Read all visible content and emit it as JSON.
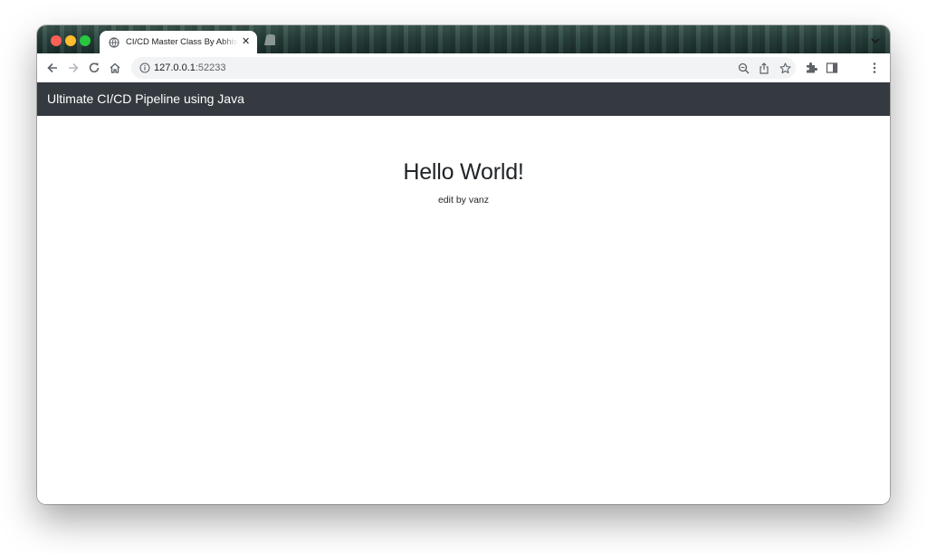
{
  "browser": {
    "tab": {
      "title": "CI/CD Master Class By Abhishek",
      "favicon": "globe-icon",
      "close_glyph": "✕"
    },
    "address": {
      "host": "127.0.0.1",
      "port": ":52233"
    },
    "toolbar_icons": [
      "back-icon",
      "forward-icon",
      "reload-icon",
      "home-icon",
      "info-icon",
      "zoom-icon",
      "share-icon",
      "star-icon",
      "extensions-icon",
      "sidepanel-icon",
      "menu-icon"
    ]
  },
  "navbar": {
    "brand": "Ultimate CI/CD Pipeline using Java",
    "background": "#343a40"
  },
  "main": {
    "heading": "Hello World!",
    "subtext": "edit by vanz"
  },
  "colors": {
    "traffic_red": "#fe5f57",
    "traffic_yellow": "#febc2e",
    "traffic_green": "#28c840"
  }
}
